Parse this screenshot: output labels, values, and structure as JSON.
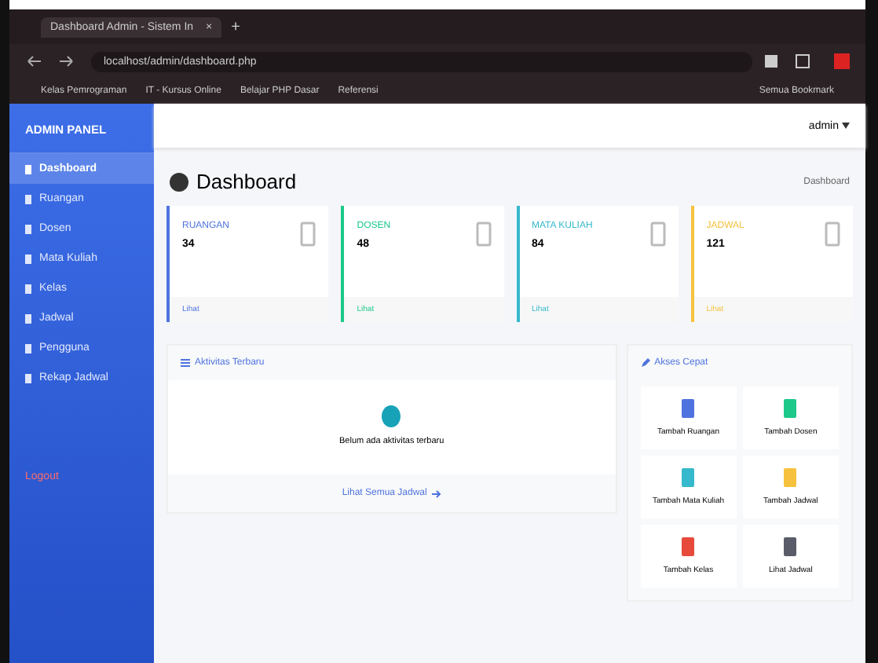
{
  "browser": {
    "tab_title": "Dashboard Admin - Sistem In",
    "close": "×",
    "new_tab": "+",
    "url": "localhost/admin/dashboard.php",
    "bookmarks": [
      "Kelas Pemrograman",
      "IT - Kursus Online",
      "Belajar PHP Dasar",
      "Referensi"
    ],
    "other_bookmarks": "Semua Bookmark"
  },
  "sidebar": {
    "brand": "ADMIN PANEL",
    "items": [
      {
        "label": "Dashboard",
        "selected": true
      },
      {
        "label": "Ruangan",
        "selected": false
      },
      {
        "label": "Dosen",
        "selected": false
      },
      {
        "label": "Mata Kuliah",
        "selected": false
      },
      {
        "label": "Kelas",
        "selected": false
      },
      {
        "label": "Jadwal",
        "selected": false
      },
      {
        "label": "Pengguna",
        "selected": false
      },
      {
        "label": "Rekap Jadwal",
        "selected": false
      }
    ],
    "logout": "Logout"
  },
  "topbar": {
    "user": "admin"
  },
  "page": {
    "title": "Dashboard",
    "breadcrumb": "Dashboard"
  },
  "cards": [
    {
      "label": "RUANGAN",
      "value": "34",
      "link": "Lihat",
      "color": "#4e73df"
    },
    {
      "label": "DOSEN",
      "value": "48",
      "link": "Lihat",
      "color": "#1cc88a"
    },
    {
      "label": "MATA KULIAH",
      "value": "84",
      "link": "Lihat",
      "color": "#36b9cc"
    },
    {
      "label": "JADWAL",
      "value": "121",
      "link": "Lihat",
      "color": "#f6c23e"
    }
  ],
  "activity": {
    "title": "Aktivitas Terbaru",
    "empty": "Belum ada aktivitas terbaru",
    "link": "Lihat Semua Jadwal"
  },
  "quick": {
    "title": "Akses Cepat",
    "items": [
      {
        "label": "Tambah Ruangan",
        "color": "#4e73df"
      },
      {
        "label": "Tambah Dosen",
        "color": "#1cc88a"
      },
      {
        "label": "Tambah Mata Kuliah",
        "color": "#36b9cc"
      },
      {
        "label": "Tambah Jadwal",
        "color": "#f6c23e"
      },
      {
        "label": "Tambah Kelas",
        "color": "#e74a3b"
      },
      {
        "label": "Lihat Jadwal",
        "color": "#5a5c69"
      }
    ]
  }
}
